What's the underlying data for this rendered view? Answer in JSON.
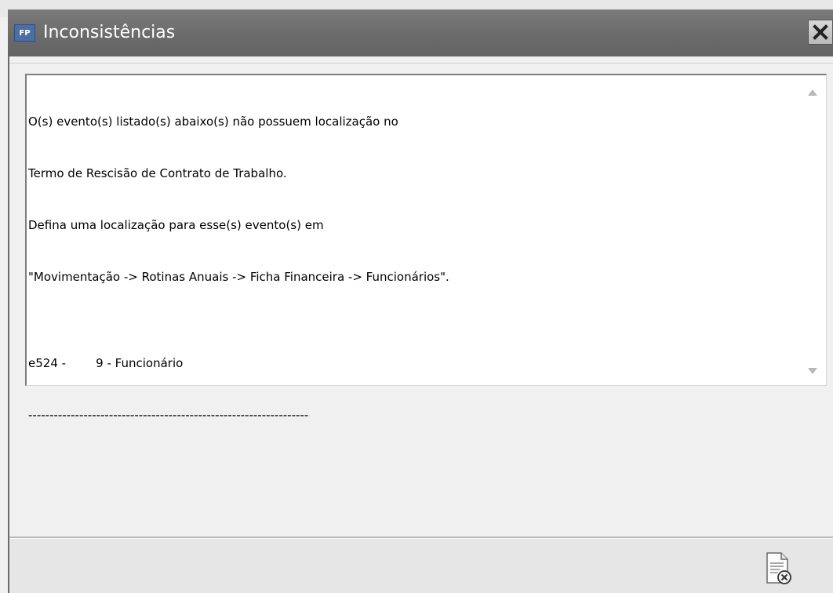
{
  "window": {
    "app_icon_label": "FP",
    "title": "Inconsistências"
  },
  "memo": {
    "lines": [
      "O(s) evento(s) listado(s) abaixo(s) não possuem localização no",
      "Termo de Rescisão de Contrato de Trabalho.",
      "Defina uma localização para esse(s) evento(s) em",
      "\"Movimentação -> Rotinas Anuais -> Ficha Financeira -> Funcionários\".",
      "",
      "e524 -        9 - Funcionário",
      "------------------------------------------------------------------"
    ]
  },
  "icons": {
    "close": "close-icon",
    "scroll_up": "scroll-up-arrow-icon",
    "scroll_down": "scroll-down-arrow-icon",
    "close_document": "document-close-icon"
  },
  "colors": {
    "titlebar": "#6d6d6d",
    "memo_background": "#ffffff",
    "window_background": "#f0f0f0"
  }
}
